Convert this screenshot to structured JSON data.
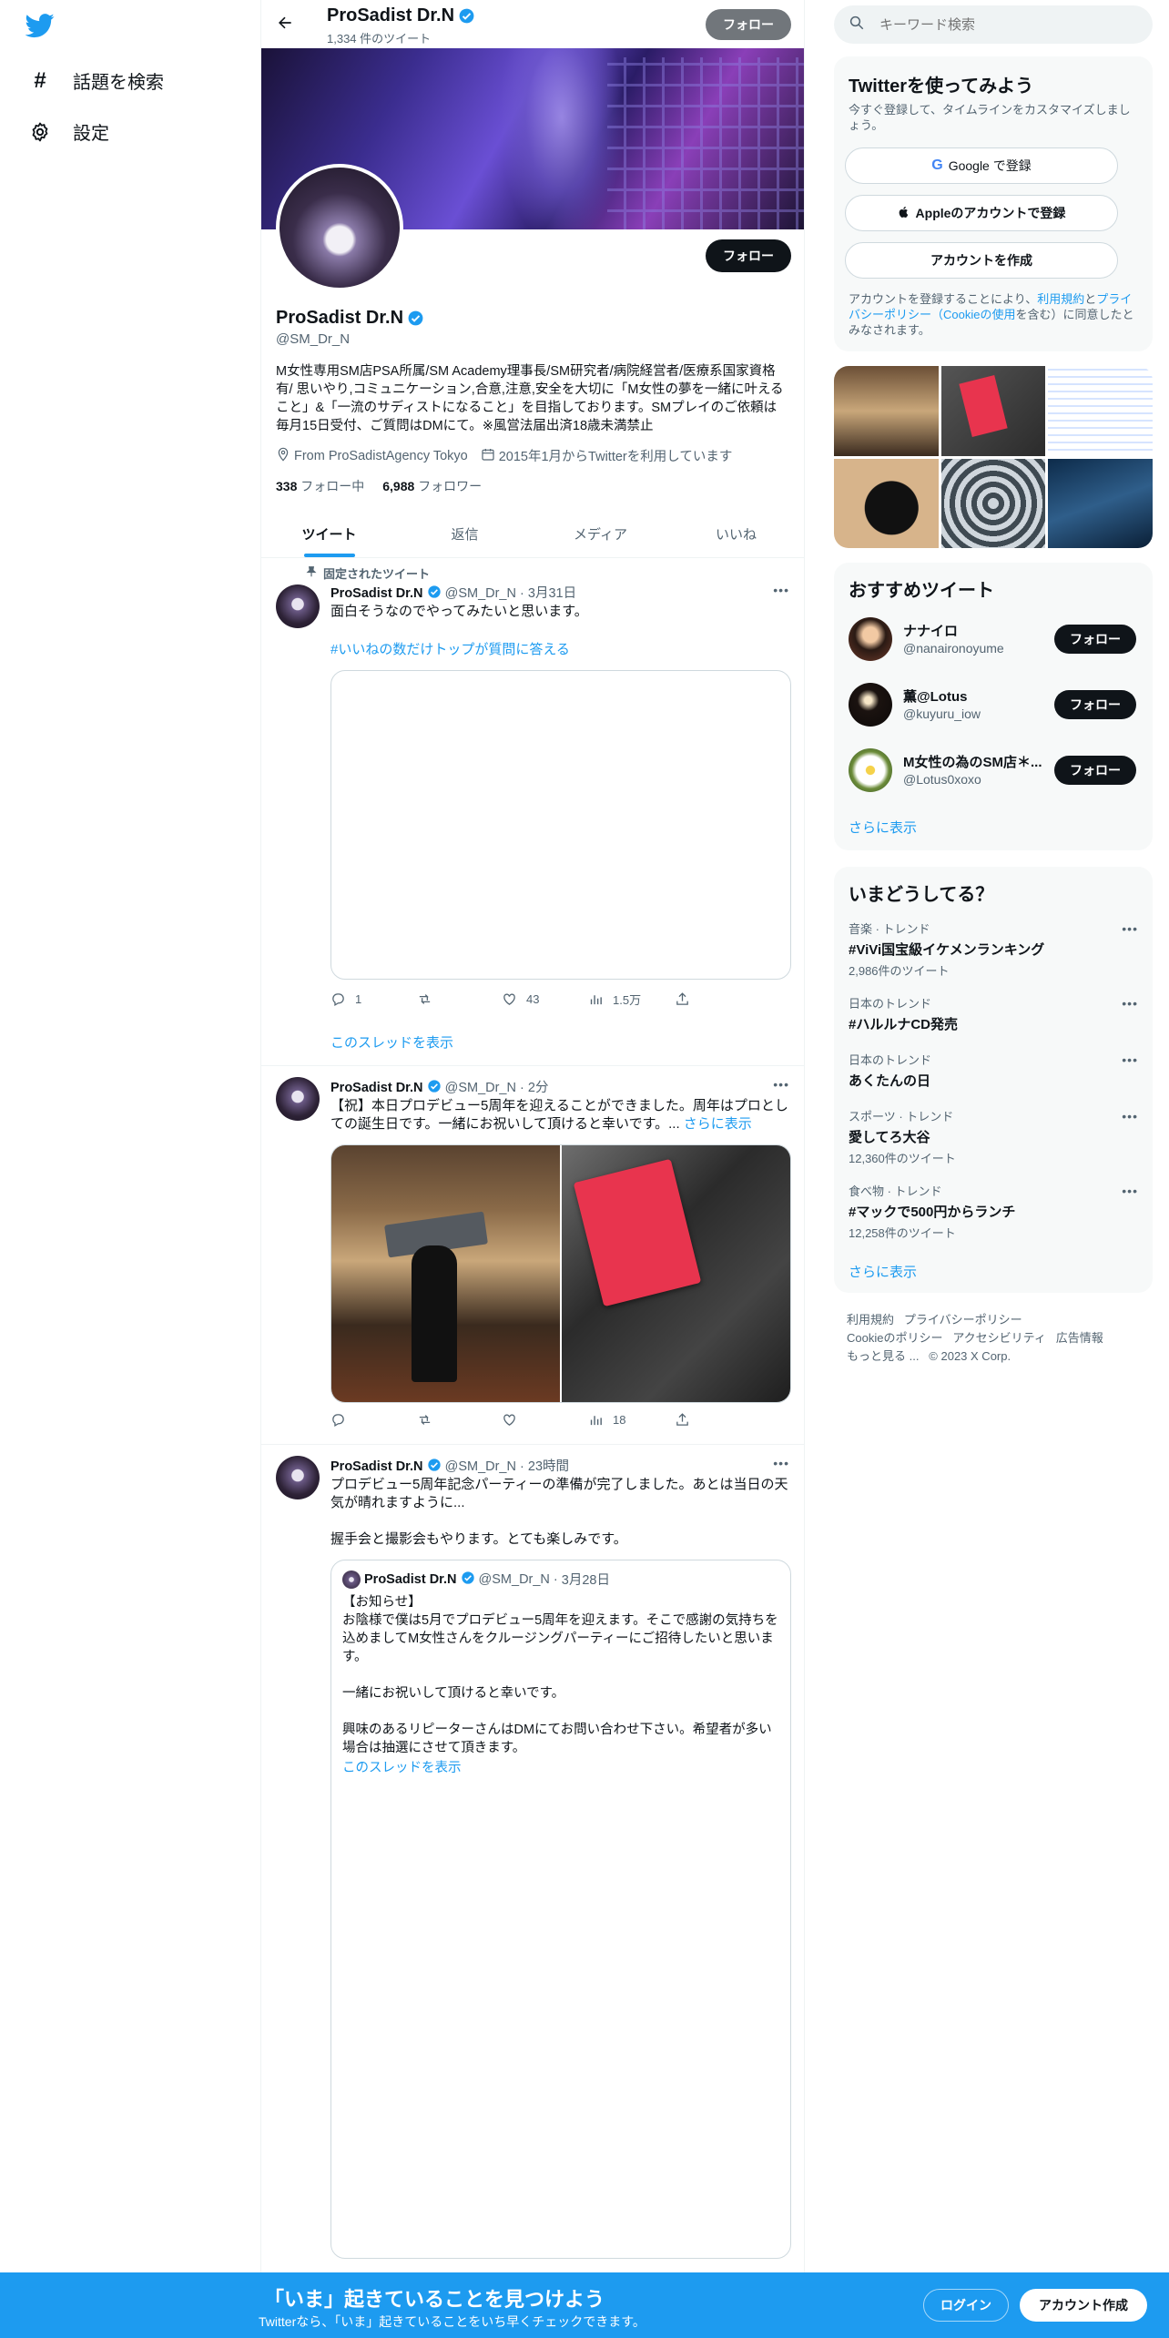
{
  "nav": {
    "explore_label": "話題を検索",
    "settings_label": "設定"
  },
  "header": {
    "name": "ProSadist Dr.N",
    "tweet_count": "1,334 件のツイート",
    "follow_label": "フォロー"
  },
  "profile": {
    "name": "ProSadist Dr.N",
    "handle": "@SM_Dr_N",
    "follow_label": "フォロー",
    "bio": "M女性専用SM店PSA所属/SM Academy理事長/SM研究者/病院経営者/医療系国家資格有/ 思いやり,コミュニケーション,合意,注意,安全を大切に「M女性の夢を一緒に叶えること」&「一流のサディストになること」を目指しております。SMプレイのご依頼は毎月15日受付、ご質問はDMにて。※風営法届出済18歳未満禁止",
    "location": "From ProSadistAgency Tokyo",
    "joined": "2015年1月からTwitterを利用しています",
    "following_count": "338",
    "following_label": "フォロー中",
    "followers_count": "6,988",
    "followers_label": "フォロワー"
  },
  "tabs": [
    "ツイート",
    "返信",
    "メディア",
    "いいね"
  ],
  "tweets": [
    {
      "pinned_label": "固定されたツイート",
      "name": "ProSadist Dr.N",
      "handle": "@SM_Dr_N",
      "time": "3月31日",
      "text": "面白そうなのでやってみたいと思います。",
      "hashtag": "#いいねの数だけトップが質問に答える",
      "reply_count": "1",
      "retweet_count": "",
      "like_count": "43",
      "view_count": "1.5万",
      "thread_label": "このスレッドを表示"
    },
    {
      "name": "ProSadist Dr.N",
      "handle": "@SM_Dr_N",
      "time": "2分",
      "text": "【祝】本日プロデビュー5周年を迎えることができました。周年は",
      "text2": "プロとしての誕生日です。一緒にお祝いして頂けると幸いです。...",
      "show_more": "さらに表示",
      "view_count": "18"
    },
    {
      "name": "ProSadist Dr.N",
      "handle": "@SM_Dr_N",
      "time": "23時間",
      "text": "プロデビュー5周年記念パーティーの準備が完了しました。あとは当日の天気が晴れますように...\n\n握手会と撮影会もやります。とても楽しみです。",
      "quote": {
        "name": "ProSadist Dr.N",
        "handle": "@SM_Dr_N",
        "time": "3月28日",
        "text": "【お知らせ】\nお陰様で僕は5月でプロデビュー5周年を迎えます。そこで感謝の気持ちを込めましてM女性さんをクルージングパーティーにご招待したいと思います。\n\n一緒にお祝いして頂けると幸いです。\n\n興味のあるリピーターさんはDMにてお問い合わせ下さい。希望者が多い場合は抽選にさせて頂きます。",
        "thread_label": "このスレッドを表示"
      }
    }
  ],
  "search": {
    "placeholder": "キーワード検索"
  },
  "signup": {
    "title": "Twitterを使ってみよう",
    "subtitle": "今すぐ登録して、タイムラインをカスタマイズしましょう。",
    "google_label": "Google で登録",
    "apple_label": "Appleのアカウントで登録",
    "create_label": "アカウントを作成",
    "legal_1": "アカウントを登録することにより、",
    "legal_terms": "利用規約",
    "legal_2": "と",
    "legal_privacy": "プライバシーポリシー（Cookieの使用",
    "legal_3": "を含む）に同意したとみなされます。"
  },
  "who_to_follow": {
    "title": "おすすめツイート",
    "users": [
      {
        "name": "ナナイロ",
        "handle": "@nanaironoyume",
        "button": "フォロー"
      },
      {
        "name": "薫@Lotus",
        "handle": "@kuyuru_iow",
        "button": "フォロー"
      },
      {
        "name": "M女性の為のSM店＊...",
        "handle": "@Lotus0xoxo",
        "button": "フォロー"
      }
    ],
    "show_more": "さらに表示"
  },
  "trends": {
    "title": "いまどうしてる？",
    "items": [
      {
        "meta": "音楽 · トレンド",
        "name": "#ViVi国宝級イケメンランキング",
        "count": "2,986件のツイート"
      },
      {
        "meta": "日本のトレンド",
        "name": "#ハルルナCD発売",
        "count": ""
      },
      {
        "meta": "日本のトレンド",
        "name": "あくたんの日",
        "count": ""
      },
      {
        "meta": "スポーツ · トレンド",
        "name": "愛してろ大谷",
        "count": "12,360件のツイート"
      },
      {
        "meta": "食べ物 · トレンド",
        "name": "#マックで500円からランチ",
        "count": "12,258件のツイート"
      }
    ],
    "show_more": "さらに表示"
  },
  "footer": {
    "terms": "利用規約",
    "privacy": "プライバシーポリシー",
    "cookie": "Cookieのポリシー",
    "accessibility": "アクセシビリティ",
    "ads": "広告情報",
    "more": "もっと見る ...",
    "copyright": "© 2023 X Corp."
  },
  "banner": {
    "title": "「いま」起きていることを見つけよう",
    "subtitle": "Twitterなら、「いま」起きていることをいち早くチェックできます。",
    "login_label": "ログイン",
    "signup_label": "アカウント作成"
  },
  "colors": {
    "accent": "#1d9bf0",
    "text": "#0f1419",
    "muted": "#536471"
  }
}
